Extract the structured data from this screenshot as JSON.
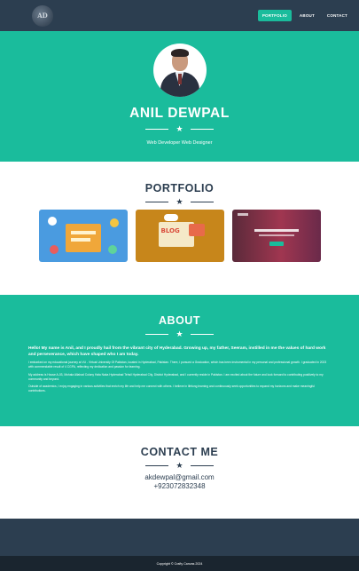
{
  "nav": {
    "links": [
      "PORTFOLIO",
      "ABOUT",
      "CONTACT"
    ]
  },
  "hero": {
    "name": "ANIL DEWPAL",
    "subtitle": "Web Developer Web Designer"
  },
  "portfolio": {
    "title": "PORTFOLIO",
    "thumb2_label": "BLOG"
  },
  "about": {
    "title": "ABOUT",
    "lead": "Hello! My name is Anil, and I proudly hail from the vibrant city of Hyderabad. Growing up, my father, Seeram, instilled in me the values of hard work and perseverance, which have shaped who I am today.",
    "p1": "I embarked on my educational journey at VU - Virtual University Of Pakistan, located in Hyderabad, Pakistan. There, I pursued a Graduation, which has been instrumental in my personal and professional growth. I graduated in 2023 with commendable result of 4 CGPA, reflecting my dedication and passion for learning.",
    "p2": "My address is House A-03, Mohala Allahad Colony Hala Naka Hyderabad Tehsil Hyderabad City, District Hyderabad, and I currently reside in Pakistan. I am excited about the future and look forward to contributing positively to my community and beyond.",
    "p3": "Outside of academics, I enjoy engaging in various activities that enrich my life and help me connect with others. I believe in lifelong learning and continuously seek opportunities to expand my horizons and make meaningful contributions."
  },
  "contact": {
    "title": "CONTACT ME",
    "email": "akdewpal@gmail.com",
    "phone": "+923072832348"
  },
  "footer": {
    "copyright": "Copyright © Crafty Canvas 2024"
  },
  "colors": {
    "accent": "#1abc9c",
    "dark": "#2c3e50",
    "darker": "#1a252f"
  }
}
